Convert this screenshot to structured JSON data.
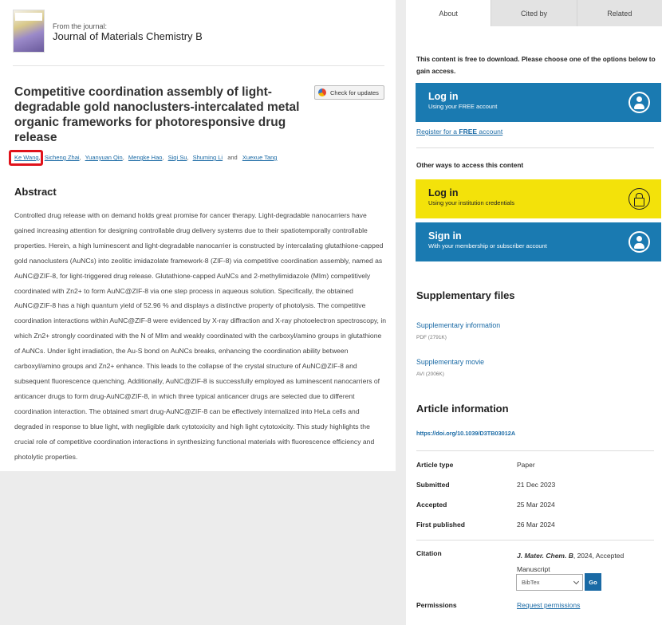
{
  "journal": {
    "from_label": "From the journal:",
    "name": "Journal of Materials Chemistry B"
  },
  "article": {
    "title": "Competitive coordination assembly of light-degradable gold nanoclusters-intercalated metal organic frameworks for photoresponsive drug release",
    "check_updates_label": "Check for updates",
    "authors": [
      "Ke Wang",
      "Sicheng Zhai",
      "Yuanyuan Qin",
      "Mengke Hao",
      "Siqi Su",
      "Shuming Li",
      "Xuexue Tang"
    ],
    "and_label": "and",
    "abstract_heading": "Abstract",
    "abstract": "Controlled drug release with on demand holds great promise for cancer therapy. Light-degradable nanocarriers have gained increasing attention for designing controllable drug delivery systems due to their spatiotemporally controllable properties. Herein, a high luminescent and light-degradable nanocarrier is constructed by intercalating glutathione-capped gold nanoclusters (AuNCs) into zeolitic imidazolate framework-8 (ZIF-8) via competitive coordination assembly, named as AuNC@ZIF-8, for light-triggered drug release. Glutathione-capped AuNCs and 2-methylimidazole (MIm) competitively coordinated with Zn2+ to form AuNC@ZIF-8 via one step process in aqueous solution. Specifically, the obtained AuNC@ZIF-8 has a high quantum yield of 52.96 % and displays a distinctive property of photolysis. The competitive coordination interactions within AuNC@ZIF-8 were evidenced by X-ray diffraction and X-ray photoelectron spectroscopy, in which Zn2+ strongly coordinated with the N of MIm and weakly coordinated with the carboxyl/amino groups in glutathione of AuNCs. Under light irradiation, the Au-S bond on AuNCs breaks, enhancing the coordination ability between carboxyl/amino groups and Zn2+ enhance. This leads to the collapse of the crystal structure of AuNC@ZIF-8 and subsequent fluorescence quenching. Additionally, AuNC@ZIF-8 is successfully employed as luminescent nanocarriers of anticancer drugs to form drug-AuNC@ZIF-8, in which three typical anticancer drugs are selected due to different coordination interaction. The obtained smart drug-AuNC@ZIF-8 can be effectively internalized into HeLa cells and degraded in response to blue light, with negligible dark cytotoxicity and high light cytotoxicity. This study highlights the crucial role of competitive coordination interactions in synthesizing functional materials with fluorescence efficiency and photolytic properties."
  },
  "sidebar": {
    "tabs": [
      "About",
      "Cited by",
      "Related"
    ],
    "free_note": "This content is free to download. Please choose one of the options below to gain access.",
    "login_free": {
      "title": "Log in",
      "subtitle": "Using your FREE account"
    },
    "register": {
      "prefix": "Register for a ",
      "bold": "FREE",
      "suffix": " account"
    },
    "other_ways": "Other ways to access this content",
    "login_institution": {
      "title": "Log in",
      "subtitle": "Using your institution credentials"
    },
    "sign_in": {
      "title": "Sign in",
      "subtitle": "With your membership or subscriber account"
    },
    "supplementary_title": "Supplementary files",
    "supplementary": [
      {
        "name": "Supplementary information",
        "meta": "PDF (2791K)"
      },
      {
        "name": "Supplementary movie",
        "meta": "AVI (2006K)"
      }
    ],
    "article_info_title": "Article information",
    "doi": "https://doi.org/10.1039/D3TB03012A",
    "info": {
      "article_type_label": "Article type",
      "article_type": "Paper",
      "submitted_label": "Submitted",
      "submitted": "21 Dec 2023",
      "accepted_label": "Accepted",
      "accepted": "25 Mar 2024",
      "first_published_label": "First published",
      "first_published": "26 Mar 2024",
      "citation_label": "Citation",
      "citation_journal": "J. Mater. Chem. B",
      "citation_rest": ", 2024, Accepted Manuscript",
      "bibtex_value": "BibTex",
      "go_label": "Go",
      "permissions_label": "Permissions",
      "permissions_link": "Request permissions"
    }
  }
}
